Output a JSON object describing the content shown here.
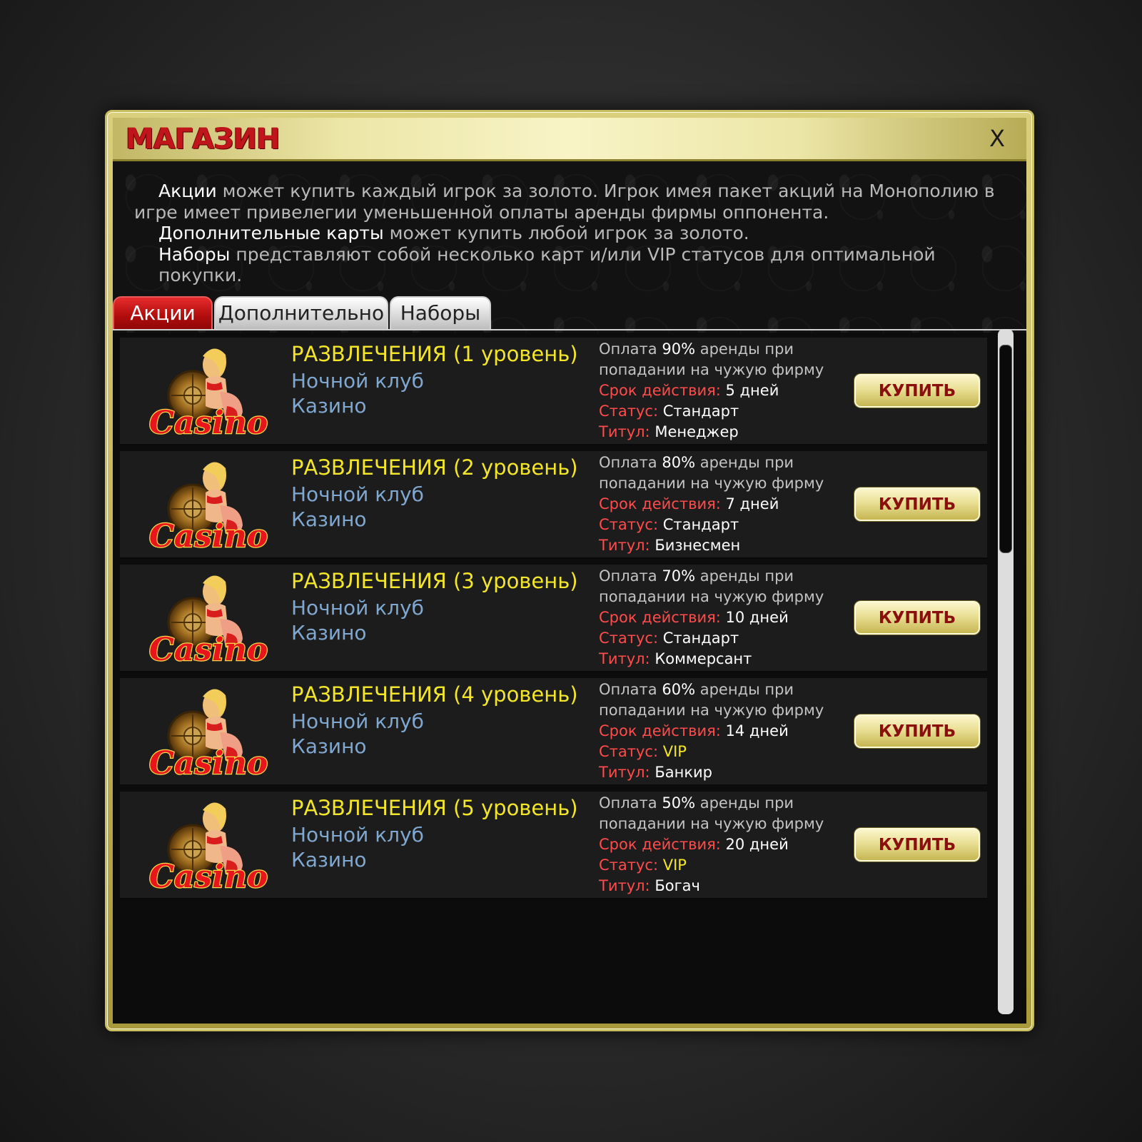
{
  "window": {
    "title": "МАГАЗИН",
    "close_label": "X"
  },
  "description": {
    "p1_bold": "Акции",
    "p1_text": " может купить каждый игрок за золото. Игрок имея пакет акций на Монополию в игре имеет привелегии уменьшенной оплаты аренды фирмы оппонента.",
    "p2_bold": "Дополнительные карты",
    "p2_text": " может купить любой игрок за золото.",
    "p3_bold": "Наборы",
    "p3_text": " представляют собой несколько карт и/или VIP статусов для оптимальной покупки."
  },
  "tabs": [
    {
      "label": "Акции",
      "active": true
    },
    {
      "label": "Дополнительно",
      "active": false
    },
    {
      "label": "Наборы",
      "active": false
    }
  ],
  "labels": {
    "pay_prefix": "Оплата",
    "pay_suffix": "аренды при",
    "pay_line2": "попадании на чужую фирму",
    "term": "Срок действия:",
    "status": "Статус:",
    "title": "Титул:",
    "buy": "КУПИТЬ"
  },
  "items": [
    {
      "name": "РАЗВЛЕЧЕНИЯ (1 уровень)",
      "sub1": "Ночной клуб",
      "sub2": "Казино",
      "logo_text": "Casino",
      "percent": "90%",
      "term": "5 дней",
      "status": "Стандарт",
      "title": "Менеджер"
    },
    {
      "name": "РАЗВЛЕЧЕНИЯ (2 уровень)",
      "sub1": "Ночной клуб",
      "sub2": "Казино",
      "logo_text": "Casino",
      "percent": "80%",
      "term": "7 дней",
      "status": "Стандарт",
      "title": "Бизнесмен"
    },
    {
      "name": "РАЗВЛЕЧЕНИЯ (3 уровень)",
      "sub1": "Ночной клуб",
      "sub2": "Казино",
      "logo_text": "Casino",
      "percent": "70%",
      "term": "10 дней",
      "status": "Стандарт",
      "title": "Коммерсант"
    },
    {
      "name": "РАЗВЛЕЧЕНИЯ (4 уровень)",
      "sub1": "Ночной клуб",
      "sub2": "Казино",
      "logo_text": "Casino",
      "percent": "60%",
      "term": "14 дней",
      "status": "VIP",
      "title": "Банкир"
    },
    {
      "name": "РАЗВЛЕЧЕНИЯ (5 уровень)",
      "sub1": "Ночной клуб",
      "sub2": "Казино",
      "logo_text": "Casino",
      "percent": "50%",
      "term": "20 дней",
      "status": "VIP",
      "title": "Богач"
    }
  ],
  "scroll": {
    "position": 0.0,
    "visible_fraction": 0.3
  }
}
